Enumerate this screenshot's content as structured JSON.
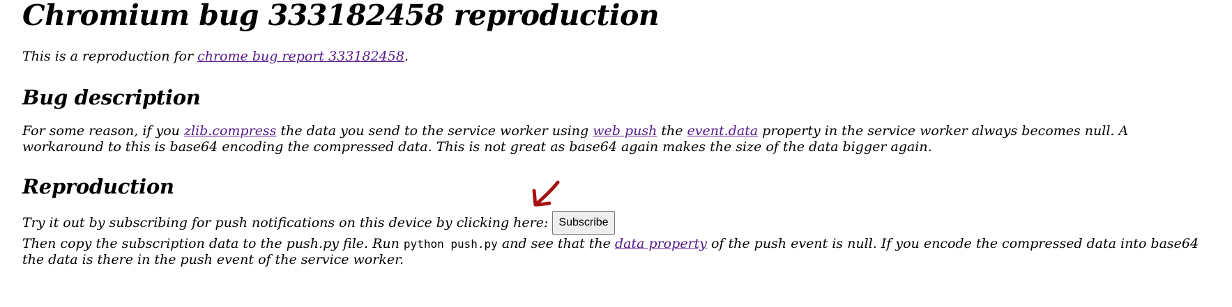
{
  "heading": {
    "title": "Chromium bug 333182458 reproduction"
  },
  "intro": {
    "prefix": "This is a reproduction for ",
    "link": "chrome bug report 333182458",
    "suffix": "."
  },
  "bug_section": {
    "title": "Bug description",
    "text1": "For some reason, if you ",
    "link_zlib": "zlib.compress",
    "text2": " the data you send to the service worker using ",
    "link_webpush": "web push",
    "text3": " the ",
    "link_eventdata": "event.data",
    "text4": " property in the service worker always becomes null. A workaround to this is base64 encoding the compressed data. This is not great as base64 again makes the size of the data bigger again."
  },
  "repro_section": {
    "title": "Reproduction",
    "try_text": "Try it out by subscribing for push notifications on this device by clicking here:",
    "subscribe_label": "Subscribe",
    "then_text1": "Then copy the subscription data to the push.py file. Run ",
    "code": "python push.py",
    "then_text2": " and see that the ",
    "link_dataprop": "data property",
    "then_text3": " of the push event is null. If you encode the compressed data into base64 the data is there in the push event of the service worker."
  },
  "colors": {
    "link": "#551a8b",
    "arrow": "#a51212"
  },
  "icons": {
    "arrow": "arrow-down-left-icon"
  }
}
